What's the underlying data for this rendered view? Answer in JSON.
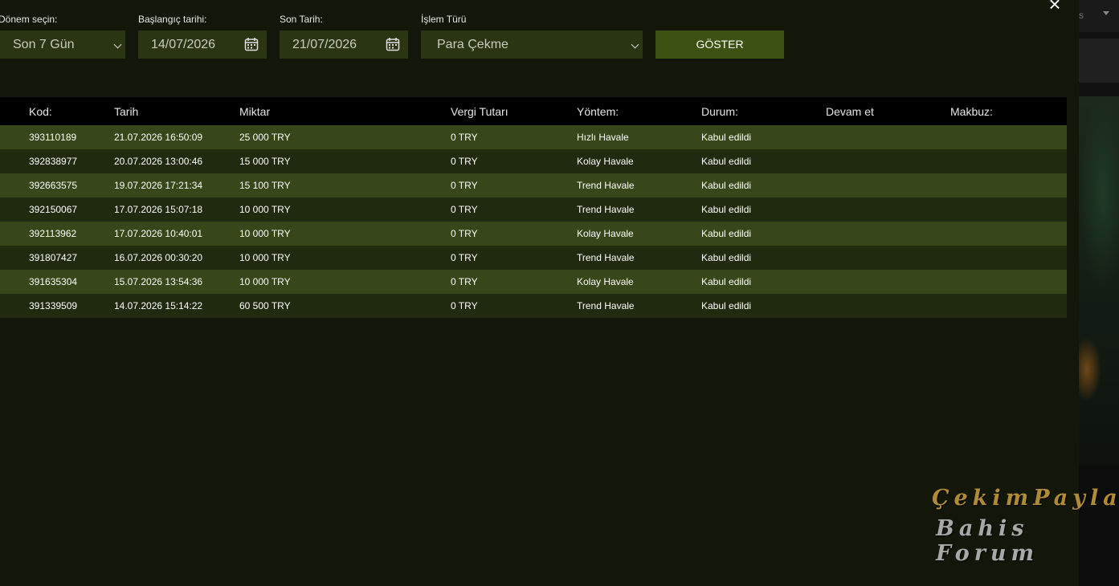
{
  "header": {
    "close_icon": "close-icon"
  },
  "filters": {
    "period": {
      "label": "Dönem seçin:",
      "value": "Son 7 Gün"
    },
    "start": {
      "label": "Başlangıç tarihi:",
      "value": "14/07/2026"
    },
    "end": {
      "label": "Son Tarih:",
      "value": "21/07/2026"
    },
    "type": {
      "label": "İşlem Türü",
      "value": "Para Çekme"
    },
    "show_label": "GÖSTER"
  },
  "table": {
    "columns": [
      "Kod:",
      "Tarih",
      "Miktar",
      "Vergi Tutarı",
      "Yöntem:",
      "Durum:",
      "Devam et",
      "Makbuz:"
    ],
    "rows": [
      [
        "393110189",
        "21.07.2026 16:50:09",
        "25 000 TRY",
        "0 TRY",
        "Hızlı Havale",
        "Kabul edildi"
      ],
      [
        "392838977",
        "20.07.2026 13:00:46",
        "15 000 TRY",
        "0 TRY",
        "Kolay Havale",
        "Kabul edildi"
      ],
      [
        "392663575",
        "19.07.2026 17:21:34",
        "15 100 TRY",
        "0 TRY",
        "Trend Havale",
        "Kabul edildi"
      ],
      [
        "392150067",
        "17.07.2026 15:07:18",
        "10 000 TRY",
        "0 TRY",
        "Trend Havale",
        "Kabul edildi"
      ],
      [
        "392113962",
        "17.07.2026 10:40:01",
        "10 000 TRY",
        "0 TRY",
        "Kolay Havale",
        "Kabul edildi"
      ],
      [
        "391807427",
        "16.07.2026 00:30:20",
        "10 000 TRY",
        "0 TRY",
        "Trend Havale",
        "Kabul edildi"
      ],
      [
        "391635304",
        "15.07.2026 13:54:36",
        "10 000 TRY",
        "0 TRY",
        "Kolay Havale",
        "Kabul edildi"
      ],
      [
        "391339509",
        "14.07.2026 15:14:22",
        "60 500 TRY",
        "0 TRY",
        "Trend Havale",
        "Kabul edildi"
      ]
    ]
  },
  "background": {
    "topbar_text": "s"
  },
  "watermark": {
    "line1": "ÇekimPaylaş",
    "line2": "Bahis Forum"
  }
}
